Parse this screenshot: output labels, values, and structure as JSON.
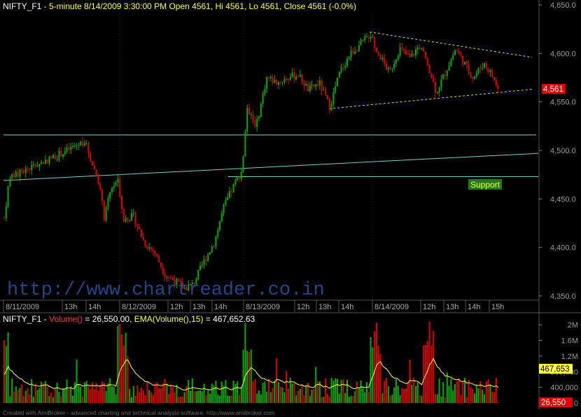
{
  "price_panel": {
    "header_symbol": "NIFTY_F1",
    "header_text": " - 5-minute 8/14/2009 3:30:00 PM Open 4561, Hi 4561, Lo 4561, Close 4561 (-0.0%)",
    "last_price_label": "4,561",
    "support_label": "Support",
    "watermark": "http://www.chartreader.co.in",
    "y_ticks": [
      "4,650.0",
      "4,600.0",
      "4,550.0",
      "4,500.0",
      "4,450.0",
      "4,400.0",
      "4,350.0"
    ],
    "x_ticks": [
      "8/11/2009",
      "13h",
      "14h",
      "8/12/2009",
      "12h",
      "13h",
      "14h",
      "8/13/2009",
      "12h",
      "13h",
      "14h",
      "8/14/2009",
      "12h",
      "13h",
      "14h",
      "15h"
    ]
  },
  "volume_panel": {
    "header_symbol": "NIFTY_F1",
    "header_sep": " - ",
    "volume_label": "Volume()",
    "volume_value": " = 26,550.00, ",
    "ema_label": "EMA(Volume(),15)",
    "ema_value": " = 467,652.63",
    "ema_badge": "467,653",
    "volume_badge": "26,550",
    "y_ticks": [
      "2M",
      "1.6M",
      "1.2M",
      "800,000",
      "400,000",
      "0"
    ]
  },
  "footer_text": "Created with AmiBroker - advanced charting and technical analysis software. http://www.amibroker.com",
  "colors": {
    "background": "#000000",
    "up_candle": "#00b000",
    "down_candle": "#e00000",
    "trendline": "#7fd0c8",
    "triangle": "#e8e000",
    "ema_line": "#ffff40",
    "watermark": "#3050a0",
    "grid": "#303030",
    "support_bg": "#1e7a1e",
    "support_fg": "#ffff00"
  },
  "chart_data": [
    {
      "type": "candlestick",
      "title": "NIFTY_F1 - 5-minute",
      "ylim": [
        4340,
        4660
      ],
      "ohlc_by_day": [
        {
          "day": "8/11/2009",
          "open": 4430,
          "high": 4515,
          "low": 4425,
          "close": 4480
        },
        {
          "day": "8/12/2009",
          "open": 4475,
          "high": 4478,
          "low": 4355,
          "close": 4470
        },
        {
          "day": "8/13/2009",
          "open": 4545,
          "high": 4622,
          "low": 4520,
          "close": 4605
        },
        {
          "day": "8/14/2009",
          "open": 4605,
          "high": 4615,
          "low": 4555,
          "close": 4561
        }
      ],
      "horizontal_levels": [
        4516,
        4473
      ],
      "triangle_upper": [
        [
          4622,
          4596
        ]
      ],
      "triangle_lower": [
        [
          4543,
          4563
        ]
      ]
    },
    {
      "type": "bar",
      "title": "Volume()",
      "ylim": [
        0,
        2200000
      ],
      "last_volume": 26550,
      "last_ema": 467652.63
    }
  ]
}
